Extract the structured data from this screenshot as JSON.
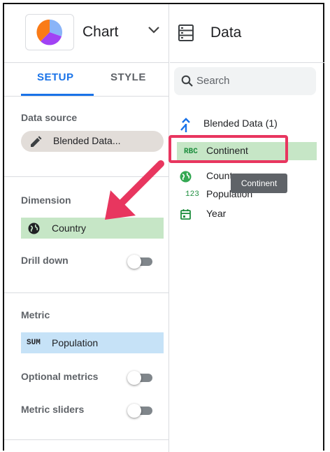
{
  "chart_panel": {
    "title": "Chart",
    "tabs": [
      {
        "label": "SETUP",
        "active": true
      },
      {
        "label": "STYLE",
        "active": false
      }
    ],
    "data_source": {
      "label": "Data source",
      "value": "Blended Data..."
    },
    "dimension": {
      "label": "Dimension",
      "field": "Country",
      "field_icon": "globe-icon"
    },
    "drill_down": {
      "label": "Drill down",
      "enabled": false
    },
    "metric": {
      "label": "Metric",
      "aggregation": "SUM",
      "field": "Population"
    },
    "optional_metrics": {
      "label": "Optional metrics",
      "enabled": false
    },
    "metric_sliders": {
      "label": "Metric sliders",
      "enabled": false
    }
  },
  "data_panel": {
    "title": "Data",
    "search_placeholder": "Search",
    "source": "Blended Data (1)",
    "fields": [
      {
        "type_label": "RBC",
        "name": "Continent",
        "icon": "text-type-icon",
        "selected": true
      },
      {
        "type_label": "",
        "name": "Country",
        "icon": "globe-icon",
        "selected": false
      },
      {
        "type_label": "123",
        "name": "Population",
        "icon": "number-type-icon",
        "selected": false
      },
      {
        "type_label": "",
        "name": "Year",
        "icon": "calendar-icon",
        "selected": false
      }
    ],
    "tooltip": "Continent"
  },
  "colors": {
    "accent": "#1a73e8",
    "dimension_chip": "#c6e6c6",
    "metric_chip": "#c6e2f7",
    "highlight": "#e8365f"
  }
}
